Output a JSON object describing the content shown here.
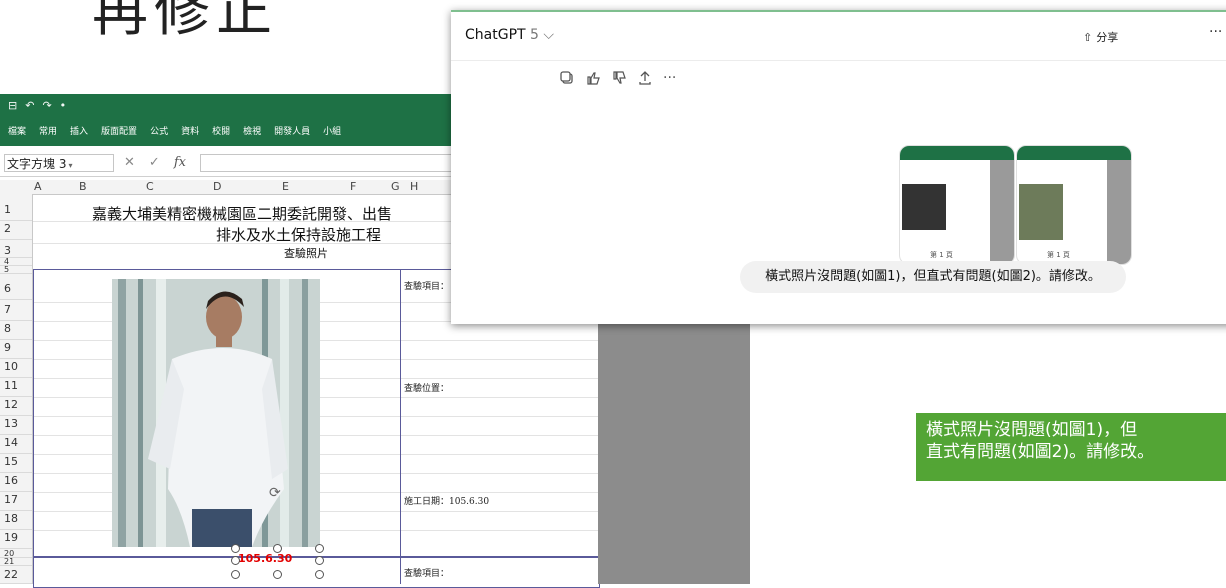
{
  "slide": {
    "title_fragment": "再修正"
  },
  "excel": {
    "qat": [
      "⊟",
      "↶",
      "↷",
      "•"
    ],
    "ribbon_tabs": [
      "檔案",
      "常用",
      "插入",
      "版面配置",
      "公式",
      "資料",
      "校閱",
      "檢視",
      "開發人員",
      "小組"
    ],
    "name_box": "文字方塊 3",
    "fx_label": "fx",
    "columns": [
      "A",
      "B",
      "C",
      "D",
      "E",
      "F",
      "G",
      "H"
    ],
    "rows": [
      "1",
      "2",
      "3",
      "4",
      "5",
      "6",
      "7",
      "8",
      "9",
      "10",
      "11",
      "12",
      "13",
      "14",
      "15",
      "16",
      "17",
      "18",
      "19",
      "20",
      "21",
      "22"
    ],
    "title_line1": "嘉義大埔美精密機械園區二期委託開發、出售",
    "title_line2": "排水及水土保持設施工程",
    "title_line3": "查驗照片",
    "label_item": "查驗項目：",
    "label_location": "查驗位置：",
    "label_date": "施工日期：105.6.30",
    "label_item2": "查驗項目：",
    "photo_date_overlay": "105.6.30"
  },
  "chat": {
    "model_name": "ChatGPT",
    "model_version": "5",
    "share_label": "分享",
    "more_label": "···",
    "thumb1_page": "第 1 頁",
    "thumb2_page": "第 1 頁",
    "message": "橫式照片沒問題(如圖1)，但直式有問題(如圖2)。請修改。"
  },
  "callout": {
    "line1": "橫式照片沒問題(如圖1)，但",
    "line2": "直式有問題(如圖2)。請修改。"
  },
  "colors": {
    "excel_green": "#1e7145",
    "callout_green": "#53a535",
    "date_red": "#e30000"
  }
}
